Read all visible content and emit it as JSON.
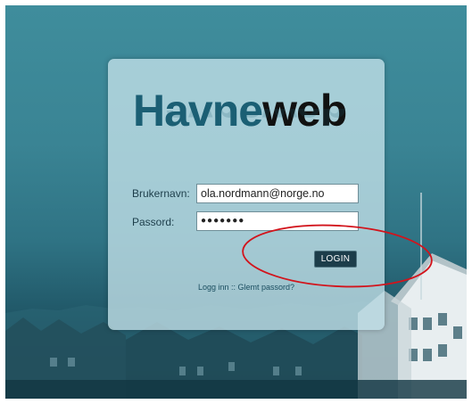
{
  "logo": {
    "part1": "Havne",
    "part2": "web"
  },
  "form": {
    "username_label": "Brukernavn:",
    "username_value": "ola.nordmann@norge.no",
    "password_label": "Passord:",
    "password_mask": "●●●●●●●",
    "login_label": "LOGIN"
  },
  "links": {
    "login": "Logg inn",
    "separator": " :: ",
    "forgot": "Glemt passord?"
  },
  "colors": {
    "brand_blue": "#1b5f74",
    "button_bg": "#1c3d4a",
    "annotation_ring": "#d2141c"
  }
}
